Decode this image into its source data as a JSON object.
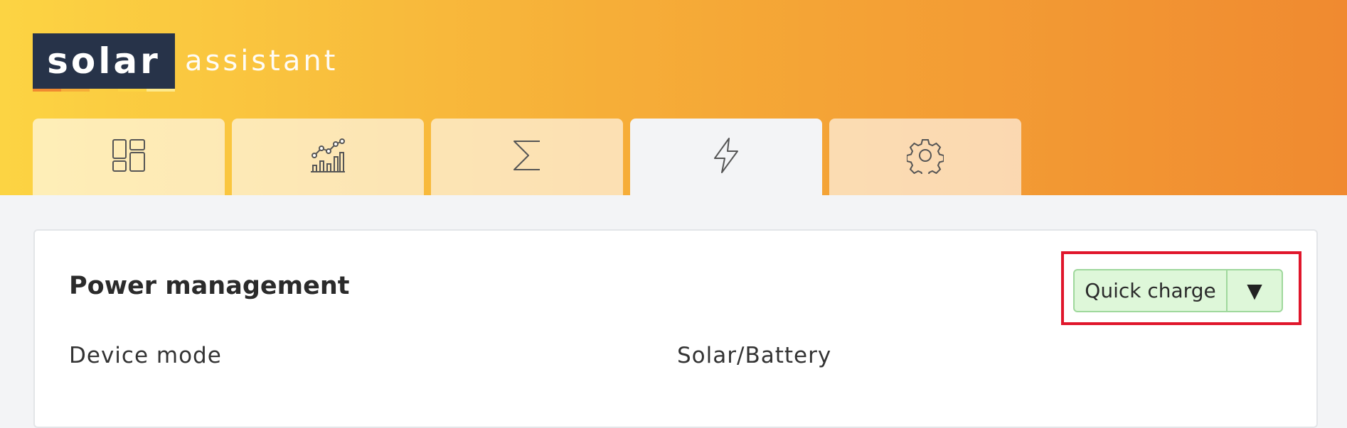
{
  "brand": {
    "word1": "solar",
    "word2": "assistant"
  },
  "tabs": [
    {
      "icon": "dashboard-icon"
    },
    {
      "icon": "chart-icon"
    },
    {
      "icon": "sigma-icon"
    },
    {
      "icon": "lightning-icon",
      "active": true
    },
    {
      "icon": "gear-icon"
    }
  ],
  "power": {
    "title": "Power management",
    "device_mode_label": "Device mode",
    "device_mode_value": "Solar/Battery",
    "quick_charge_label": "Quick charge",
    "dropdown_glyph": "▼"
  },
  "colors": {
    "header_start": "#fcd443",
    "header_end": "#f08a30",
    "logo_bg": "#273349",
    "button_bg": "#def7d9",
    "highlight": "#e0162b"
  }
}
